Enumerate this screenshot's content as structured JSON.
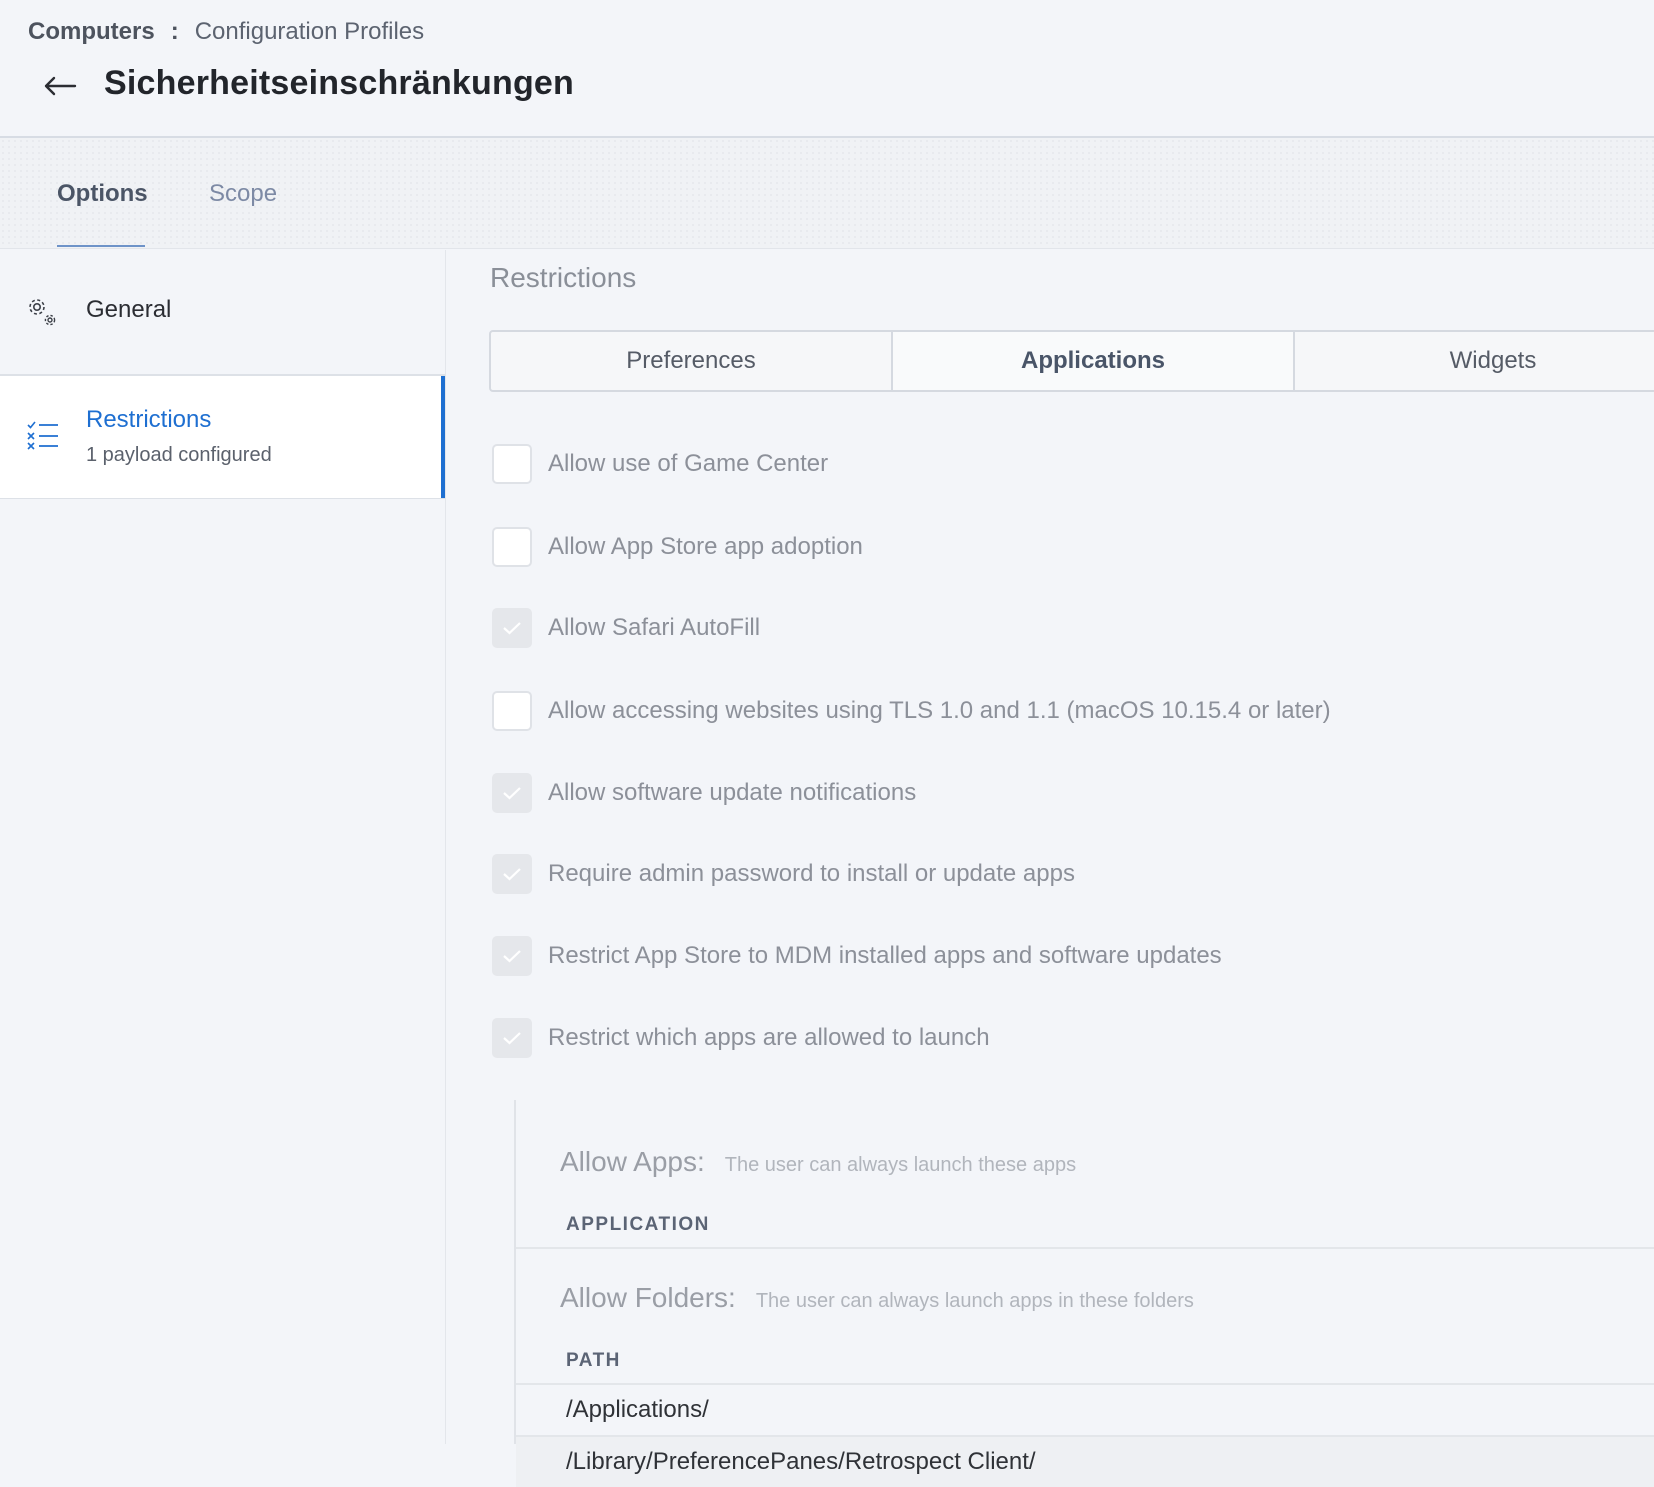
{
  "breadcrumb": {
    "root": "Computers",
    "separator": ":",
    "current": "Configuration Profiles"
  },
  "page": {
    "title": "Sicherheitseinschränkungen"
  },
  "tabs": {
    "options": "Options",
    "scope": "Scope"
  },
  "sidebar": {
    "general": {
      "label": "General",
      "icon": "gear-icon"
    },
    "restrictions": {
      "label": "Restrictions",
      "sub": "1 payload configured",
      "icon": "checklist-icon"
    }
  },
  "main": {
    "section_title": "Restrictions",
    "segments": [
      "Preferences",
      "Applications",
      "Widgets"
    ],
    "selected_segment": "Applications",
    "options": [
      {
        "label": "Allow use of Game Center",
        "checked": false
      },
      {
        "label": "Allow App Store app adoption",
        "checked": false
      },
      {
        "label": "Allow Safari AutoFill",
        "checked": true
      },
      {
        "label": "Allow accessing websites using TLS 1.0 and 1.1 (macOS 10.15.4 or later)",
        "checked": false
      },
      {
        "label": "Allow software update notifications",
        "checked": true
      },
      {
        "label": "Require admin password to install or update apps",
        "checked": true
      },
      {
        "label": "Restrict App Store to MDM installed apps and software updates",
        "checked": true
      },
      {
        "label": "Restrict which apps are allowed to launch",
        "checked": true
      }
    ],
    "allow_apps": {
      "title": "Allow Apps:",
      "description": "The user can always launch these apps",
      "column": "APPLICATION"
    },
    "allow_folders": {
      "title": "Allow Folders:",
      "description": "The user can always launch apps in these folders",
      "column": "PATH",
      "rows": [
        "/Applications/",
        "/Library/PreferencePanes/Retrospect Client/"
      ]
    }
  },
  "colors": {
    "accent": "#1e6fd1",
    "background": "#f3f5f9"
  }
}
